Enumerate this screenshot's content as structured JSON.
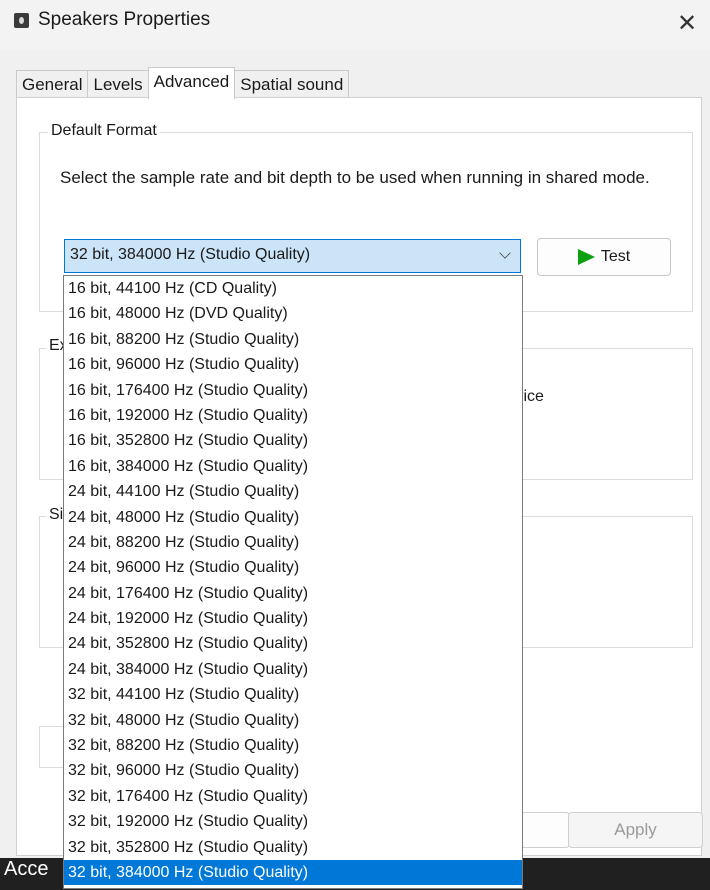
{
  "window": {
    "title": "Speakers Properties",
    "close_glyph": "✕",
    "icon": "speaker-device-icon"
  },
  "tabs": [
    {
      "label": "General",
      "active": false
    },
    {
      "label": "Levels",
      "active": false
    },
    {
      "label": "Advanced",
      "active": true
    },
    {
      "label": "Spatial sound",
      "active": false
    }
  ],
  "default_format": {
    "group_label": "Default Format",
    "description": "Select the sample rate and bit depth to be used when running in shared mode.",
    "selected_value": "32 bit, 384000 Hz (Studio Quality)",
    "test_button_label": "Test"
  },
  "partially_hidden": {
    "exclusive_group_prefix": "Ex",
    "exclusive_text_suffix": "levice",
    "signal_group_prefix": "Si"
  },
  "footer": {
    "apply_label": "Apply"
  },
  "taskbar": {
    "text": "Acce"
  },
  "dropdown_options": [
    "16 bit, 44100 Hz (CD Quality)",
    "16 bit, 48000 Hz (DVD Quality)",
    "16 bit, 88200 Hz (Studio Quality)",
    "16 bit, 96000 Hz (Studio Quality)",
    "16 bit, 176400 Hz (Studio Quality)",
    "16 bit, 192000 Hz (Studio Quality)",
    "16 bit, 352800 Hz (Studio Quality)",
    "16 bit, 384000 Hz (Studio Quality)",
    "24 bit, 44100 Hz (Studio Quality)",
    "24 bit, 48000 Hz (Studio Quality)",
    "24 bit, 88200 Hz (Studio Quality)",
    "24 bit, 96000 Hz (Studio Quality)",
    "24 bit, 176400 Hz (Studio Quality)",
    "24 bit, 192000 Hz (Studio Quality)",
    "24 bit, 352800 Hz (Studio Quality)",
    "24 bit, 384000 Hz (Studio Quality)",
    "32 bit, 44100 Hz (Studio Quality)",
    "32 bit, 48000 Hz (Studio Quality)",
    "32 bit, 88200 Hz (Studio Quality)",
    "32 bit, 96000 Hz (Studio Quality)",
    "32 bit, 176400 Hz (Studio Quality)",
    "32 bit, 192000 Hz (Studio Quality)",
    "32 bit, 352800 Hz (Studio Quality)",
    "32 bit, 384000 Hz (Studio Quality)"
  ],
  "selected_option_index": 23,
  "colors": {
    "accent": "#0078d7",
    "play_green": "#0aa010",
    "combo_bg": "#cce4f7"
  }
}
